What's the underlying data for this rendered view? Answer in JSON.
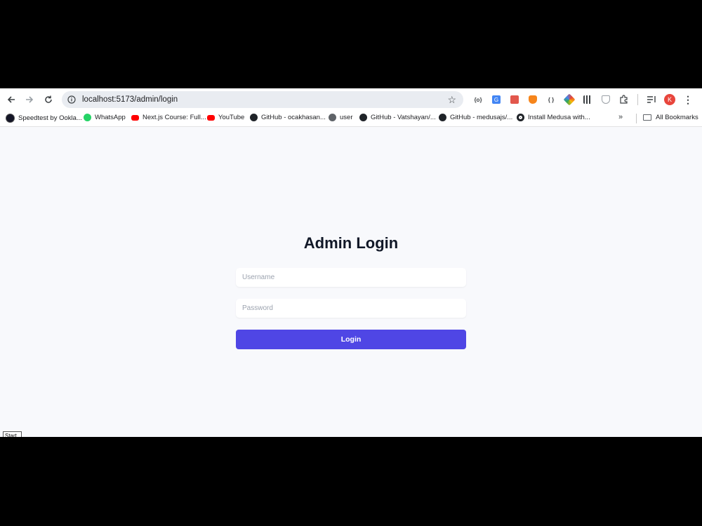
{
  "browser": {
    "url": "localhost:5173/admin/login",
    "nav": {
      "back_icon": "back-arrow-icon",
      "forward_icon": "forward-arrow-icon",
      "reload_icon": "reload-icon"
    },
    "extensions": [
      "{o}",
      "G",
      "",
      "",
      "{ }",
      "",
      "",
      "",
      "",
      ""
    ],
    "profile_initial": "K",
    "accent_profile_color": "#e8453c"
  },
  "bookmarks": {
    "items": [
      {
        "label": "Speedtest by Ookla...",
        "icon": "speedtest-icon"
      },
      {
        "label": "WhatsApp",
        "icon": "whatsapp-icon"
      },
      {
        "label": "Next.js Course: Full...",
        "icon": "youtube-icon"
      },
      {
        "label": "YouTube",
        "icon": "youtube-icon"
      },
      {
        "label": "GitHub - ocakhasan...",
        "icon": "github-icon"
      },
      {
        "label": "user",
        "icon": "globe-icon"
      },
      {
        "label": "GitHub - Vatshayan/...",
        "icon": "github-icon"
      },
      {
        "label": "GitHub - medusajs/...",
        "icon": "github-icon"
      },
      {
        "label": "Install Medusa with...",
        "icon": "medusa-icon"
      }
    ],
    "all_bookmarks": "All Bookmarks"
  },
  "login": {
    "title": "Admin Login",
    "username_placeholder": "Username",
    "password_placeholder": "Password",
    "submit_label": "Login",
    "accent": "#4f46e5"
  },
  "taskbar": {
    "start_tooltip": "Start"
  }
}
